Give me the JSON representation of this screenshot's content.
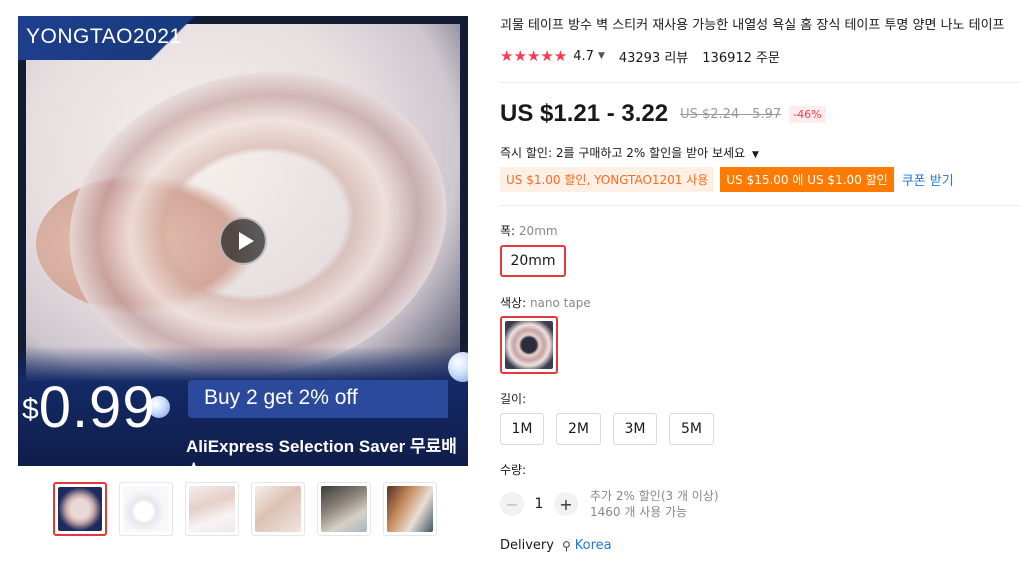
{
  "gallery": {
    "brand_tag": "YONGTAO2021",
    "promo_currency": "$",
    "promo_price": "0.99",
    "promo_text": "Buy 2 get 2% off",
    "saver_text": "AliExpress Selection Saver 무료배송",
    "thumbnail_count": 6
  },
  "product": {
    "title": "괴물 테이프 방수 벽 스티커 재사용 가능한 내열성 욕실 홈 장식 테이프 투명 양면 나노 테이프",
    "rating": "4.7",
    "stars": "★★★★★",
    "reviews": "43293 리뷰",
    "orders": "136912 주문"
  },
  "price": {
    "current": "US $1.21 - 3.22",
    "original": "US $2.24 - 5.97",
    "discount": "-46%"
  },
  "promotions": {
    "instant_discount": "즉시 할인: 2를 구매하고 2% 할인을 받아 보세요",
    "coupon_code": "US $1.00 할인, YONGTAO1201 사용",
    "coupon_threshold": "US $15.00 에 US $1.00 할인",
    "coupon_link": "쿠폰 받기"
  },
  "options": {
    "width_label": "폭:",
    "width_value": "20mm",
    "width_choices": [
      "20mm"
    ],
    "color_label": "색상:",
    "color_value": "nano tape",
    "length_label": "길이:",
    "length_choices": [
      "1M",
      "2M",
      "3M",
      "5M"
    ]
  },
  "quantity": {
    "label": "수량:",
    "value": "1",
    "minus": "−",
    "plus": "+",
    "note_discount": "추가 2% 할인(3 개 이상)",
    "note_stock": "1460 개 사용 가능"
  },
  "delivery": {
    "label": "Delivery",
    "country": "Korea"
  },
  "colors": {
    "accent": "#fd384f",
    "selected_border": "#e4393c",
    "link": "#2178d0",
    "coupon_orange": "#ff7a00"
  }
}
